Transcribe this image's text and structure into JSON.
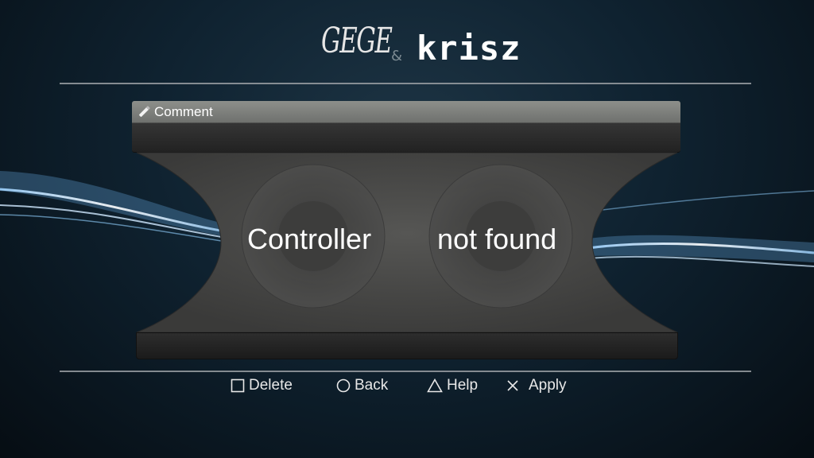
{
  "logo": {
    "left_text": "GEGE",
    "amp": "&",
    "right_text": "krisz"
  },
  "panel": {
    "title": "Comment",
    "icon": "pencil-icon"
  },
  "message": {
    "left": "Controller",
    "right": "not found"
  },
  "footer": {
    "buttons": [
      {
        "icon": "square-icon",
        "label": "Delete"
      },
      {
        "icon": "circle-icon",
        "label": "Back"
      },
      {
        "icon": "triangle-icon",
        "label": "Help"
      },
      {
        "icon": "cross-icon",
        "label": "Apply"
      }
    ]
  },
  "colors": {
    "background": "#0f2230",
    "wave": "#a9d8ff",
    "panel": "#4a4a48",
    "rule": "#9a9fa3"
  }
}
